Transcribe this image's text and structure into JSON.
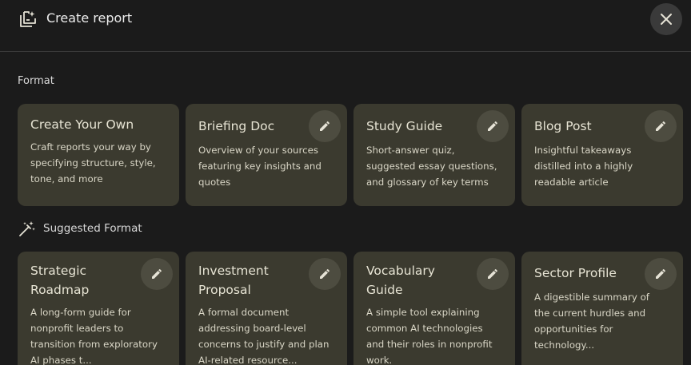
{
  "header": {
    "title": "Create report",
    "close_icon": "close-icon",
    "report_icon": "report-add-icon"
  },
  "format": {
    "label": "Format",
    "cards": [
      {
        "title": "Create Your Own",
        "desc": "Craft reports your way by specifying structure, style, tone, and more",
        "editable": false
      },
      {
        "title": "Briefing Doc",
        "desc": "Overview of your sources featuring key insights and quotes",
        "editable": true
      },
      {
        "title": "Study Guide",
        "desc": "Short-answer quiz, suggested essay questions, and glossary of key terms",
        "editable": true
      },
      {
        "title": "Blog Post",
        "desc": "Insightful takeaways distilled into a highly readable article",
        "editable": true
      }
    ]
  },
  "suggested": {
    "label": "Suggested Format",
    "icon": "magic-wand-icon",
    "cards": [
      {
        "title": "Strategic Roadmap",
        "desc": "A long-form guide for nonprofit leaders to transition from exploratory AI phases t...",
        "editable": true
      },
      {
        "title": "Investment Proposal",
        "desc": "A formal document addressing board-level concerns to justify and plan AI-related resource...",
        "editable": true
      },
      {
        "title": "Vocabulary Guide",
        "desc": "A simple tool explaining common AI technologies and their roles in nonprofit work.",
        "editable": true
      },
      {
        "title": "Sector Profile",
        "desc": "A digestible summary of the current hurdles and opportunities for technology...",
        "editable": true
      }
    ]
  },
  "colors": {
    "background": "#1b1b1b",
    "card": "#3b3a2f",
    "edit_button": "#4d4c40",
    "accent": "#e6e3d6"
  }
}
